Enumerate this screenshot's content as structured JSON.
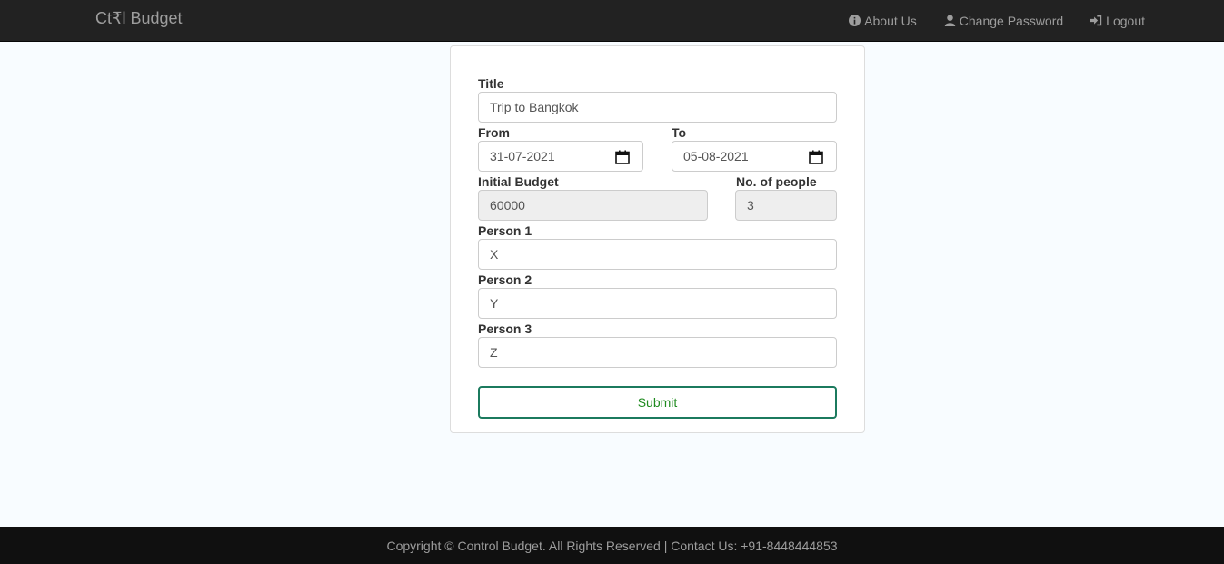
{
  "navbar": {
    "brand": "Ct₹l Budget",
    "links": [
      {
        "label": "About Us",
        "icon": "info-circle-icon"
      },
      {
        "label": "Change Password",
        "icon": "user-icon"
      },
      {
        "label": "Logout",
        "icon": "log-in-icon"
      }
    ]
  },
  "form": {
    "title": {
      "label": "Title",
      "value": "Trip to Bangkok"
    },
    "from": {
      "label": "From",
      "value": "31-07-2021"
    },
    "to": {
      "label": "To",
      "value": "05-08-2021"
    },
    "initial_budget": {
      "label": "Initial Budget",
      "value": "60000"
    },
    "num_people": {
      "label": "No. of people",
      "value": "3"
    },
    "persons": [
      {
        "label": "Person 1",
        "value": "X"
      },
      {
        "label": "Person 2",
        "value": "Y"
      },
      {
        "label": "Person 3",
        "value": "Z"
      }
    ],
    "submit_label": "Submit"
  },
  "footer": {
    "text": "Copyright © Control Budget. All Rights Reserved | Contact Us: +91-8448444853"
  },
  "colors": {
    "navbar_bg": "#222222",
    "page_bg": "#f8fcff",
    "submit_border": "#1b7a5e",
    "submit_text": "#1e8a1e",
    "footer_bg": "#101010"
  }
}
